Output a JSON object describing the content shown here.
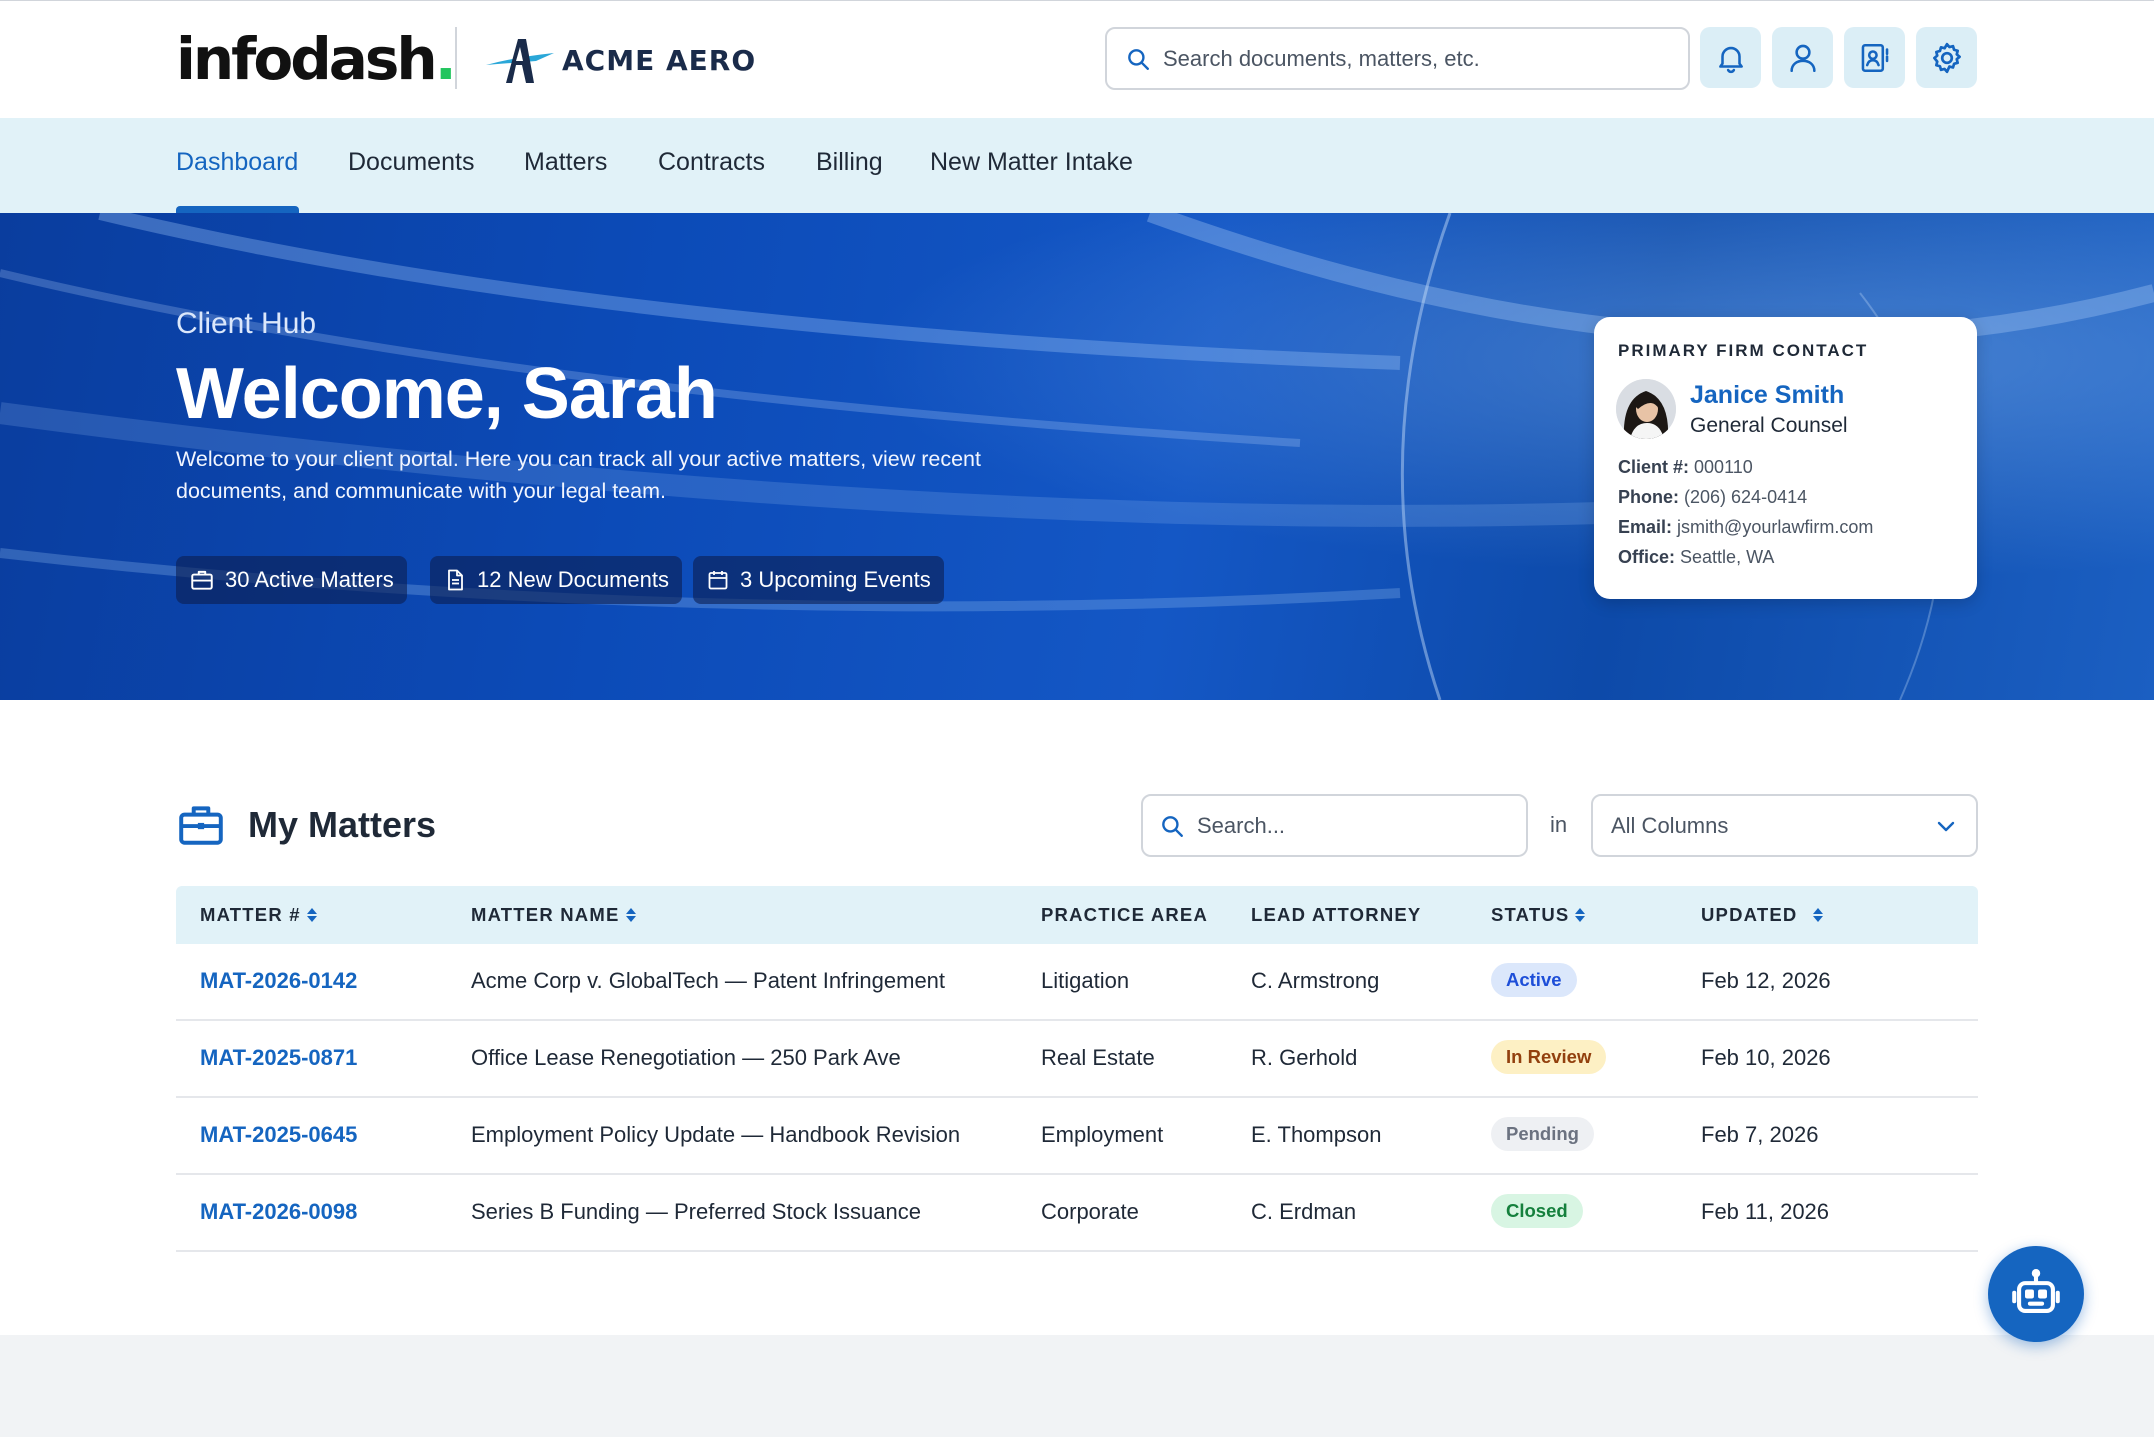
{
  "header": {
    "brand": "infodash",
    "brand_dot": ".",
    "client_brand": "ACME AERO",
    "search_placeholder": "Search documents, matters, etc."
  },
  "nav": {
    "items": [
      {
        "label": "Dashboard",
        "active": true
      },
      {
        "label": "Documents"
      },
      {
        "label": "Matters"
      },
      {
        "label": "Contracts"
      },
      {
        "label": "Billing"
      },
      {
        "label": "New Matter Intake"
      }
    ]
  },
  "hero": {
    "subtitle": "Client Hub",
    "title": "Welcome, Sarah",
    "description": "Welcome to your client portal. Here you can track all your active matters, view recent documents, and communicate with your legal team.",
    "pills": [
      {
        "icon": "briefcase-icon",
        "label": "30 Active Matters"
      },
      {
        "icon": "document-icon",
        "label": "12 New Documents"
      },
      {
        "icon": "calendar-icon",
        "label": "3 Upcoming Events"
      }
    ]
  },
  "contact": {
    "label": "PRIMARY FIRM CONTACT",
    "name": "Janice Smith",
    "role": "General Counsel",
    "client_label": "Client #:",
    "client_value": "000110",
    "phone_label": "Phone:",
    "phone_value": "(206) 624-0414",
    "email_label": "Email:",
    "email_value": "jsmith@yourlawfirm.com",
    "office_label": "Office:",
    "office_value": "Seattle, WA"
  },
  "matters": {
    "title": "My Matters",
    "search_placeholder": "Search...",
    "in_label": "in",
    "column_select": "All Columns",
    "columns": [
      "MATTER #",
      "MATTER NAME",
      "PRACTICE AREA",
      "LEAD ATTORNEY",
      "STATUS",
      "UPDATED"
    ],
    "rows": [
      {
        "id": "MAT-2026-0142",
        "name": "Acme Corp v. GlobalTech — Patent Infringement",
        "area": "Litigation",
        "attorney": "C. Armstrong",
        "status": "Active",
        "updated": "Feb 12, 2026"
      },
      {
        "id": "MAT-2025-0871",
        "name": "Office Lease Renegotiation — 250 Park Ave",
        "area": "Real Estate",
        "attorney": "R. Gerhold",
        "status": "In Review",
        "updated": "Feb 10, 2026"
      },
      {
        "id": "MAT-2025-0645",
        "name": "Employment Policy Update — Handbook Revision",
        "area": "Employment",
        "attorney": "E. Thompson",
        "status": "Pending",
        "updated": "Feb 7, 2026"
      },
      {
        "id": "MAT-2026-0098",
        "name": "Series B Funding — Preferred Stock Issuance",
        "area": "Corporate",
        "attorney": "C. Erdman",
        "status": "Closed",
        "updated": "Feb 11, 2026"
      }
    ]
  },
  "colors": {
    "accent": "#1565c0",
    "nav_bg": "#e1f2f8",
    "status_active_bg": "#dbe7fb",
    "status_active_fg": "#1d4ed8",
    "status_review_bg": "#fdf0c4",
    "status_review_fg": "#92400e",
    "status_pending_bg": "#eef0f3",
    "status_pending_fg": "#6b7280",
    "status_closed_bg": "#d8f5e3",
    "status_closed_fg": "#15803d"
  }
}
